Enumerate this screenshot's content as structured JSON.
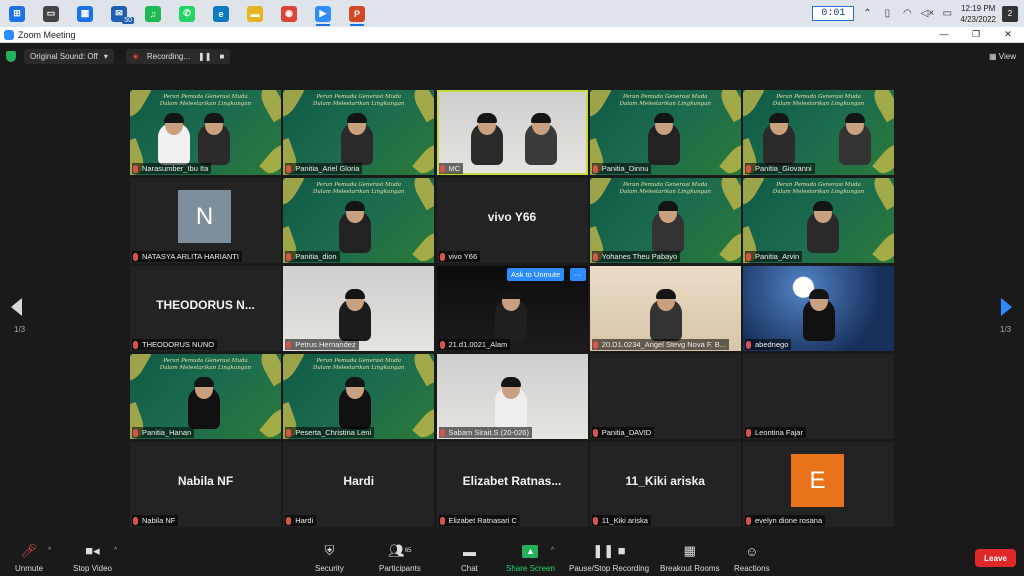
{
  "taskbar": {
    "apps": [
      {
        "name": "windows-start-icon",
        "color": "#1a73e8",
        "glyph": "⊞",
        "active": false
      },
      {
        "name": "task-view-icon",
        "color": "#444444",
        "glyph": "▭",
        "active": false
      },
      {
        "name": "store-icon",
        "color": "#1a73e8",
        "glyph": "▦",
        "active": false
      },
      {
        "name": "mail-icon",
        "color": "#1b5fb3",
        "glyph": "✉",
        "active": false
      },
      {
        "name": "spotify-icon",
        "color": "#1db954",
        "glyph": "♫",
        "active": false
      },
      {
        "name": "whatsapp-icon",
        "color": "#25d366",
        "glyph": "✆",
        "active": false
      },
      {
        "name": "edge-icon",
        "color": "#0b7ac0",
        "glyph": "e",
        "active": false
      },
      {
        "name": "file-explorer-icon",
        "color": "#e6b422",
        "glyph": "▬",
        "active": false
      },
      {
        "name": "chrome-icon",
        "color": "#db4437",
        "glyph": "◉",
        "active": false
      },
      {
        "name": "zoom-icon",
        "color": "#2d8cff",
        "glyph": "▶",
        "active": true
      },
      {
        "name": "powerpoint-icon",
        "color": "#d24726",
        "glyph": "P",
        "active": true
      }
    ],
    "mail_badge": "50",
    "timer": "0:01",
    "clock_time": "12:19 PM",
    "clock_date": "4/23/2022",
    "notification_count": "2"
  },
  "window": {
    "title": "Zoom Meeting"
  },
  "meeting_top": {
    "original_sound": "Original Sound: Off",
    "recording": "Recording...",
    "view": "View"
  },
  "tiles": [
    {
      "name": "Narasumber_Ibu Ita",
      "kind": "green"
    },
    {
      "name": "Panitia_Ariel Gloria",
      "kind": "green"
    },
    {
      "name": "MC",
      "kind": "room",
      "speaking": true
    },
    {
      "name": "Panitia_Dinnu",
      "kind": "green"
    },
    {
      "name": "Panitia_Giovanni",
      "kind": "green"
    },
    {
      "name": "NATASYA ARLITA HARIANTI",
      "kind": "avatar",
      "avatar_letter": "N",
      "avatar_color": "#7e8e9a"
    },
    {
      "name": "Panitia_dion",
      "kind": "green"
    },
    {
      "name": "vivo Y66",
      "kind": "text",
      "big_label": "vivo Y66"
    },
    {
      "name": "Yohanes Theu Pabayo",
      "kind": "green"
    },
    {
      "name": "Panitia_Arvin",
      "kind": "green"
    },
    {
      "name": "THEODORUS NUNO",
      "kind": "text",
      "big_label": "THEODORUS  N..."
    },
    {
      "name": "Petrus Hernandez",
      "kind": "room"
    },
    {
      "name": "21.d1.0021_Alam",
      "kind": "room-dark"
    },
    {
      "name": "20.D1.0234_Angel Stevg Nova F. B...",
      "kind": "wall-warm"
    },
    {
      "name": "abednego",
      "kind": "wall-blue"
    },
    {
      "name": "Panitia_Hanan",
      "kind": "green"
    },
    {
      "name": "Peserta_Christina Leni",
      "kind": "green"
    },
    {
      "name": "Sabam Sirait.S (20-026)",
      "kind": "room"
    },
    {
      "name": "Panitia_DAVID",
      "kind": "blank"
    },
    {
      "name": "Leontina Fajar",
      "kind": "blank"
    },
    {
      "name": "Nabila NF",
      "kind": "text",
      "big_label": "Nabila NF"
    },
    {
      "name": "Hardi",
      "kind": "text",
      "big_label": "Hardi"
    },
    {
      "name": "Elizabet Ratnasari C",
      "kind": "text",
      "big_label": "Elizabet  Ratnas..."
    },
    {
      "name": "11_Kiki ariska",
      "kind": "text",
      "big_label": "11_Kiki ariska"
    },
    {
      "name": "evelyn dione rosana",
      "kind": "avatar",
      "avatar_letter": "E",
      "avatar_color": "#e8731a"
    }
  ],
  "banner_text": "Peran Pemuda Generasi Muda Dalam Melestarikan Lingkungan",
  "overlay": {
    "ask_to_unmute": "Ask to Unmute",
    "more": "···"
  },
  "pagination": {
    "left": "1/3",
    "right": "1/3"
  },
  "toolbar": {
    "unmute": "Unmute",
    "stop_video": "Stop Video",
    "security": "Security",
    "participants": "Participants",
    "participants_count": "65",
    "chat": "Chat",
    "share_screen": "Share Screen",
    "pause_recording": "Pause/Stop Recording",
    "breakout_rooms": "Breakout Rooms",
    "reactions": "Reactions",
    "leave": "Leave"
  }
}
